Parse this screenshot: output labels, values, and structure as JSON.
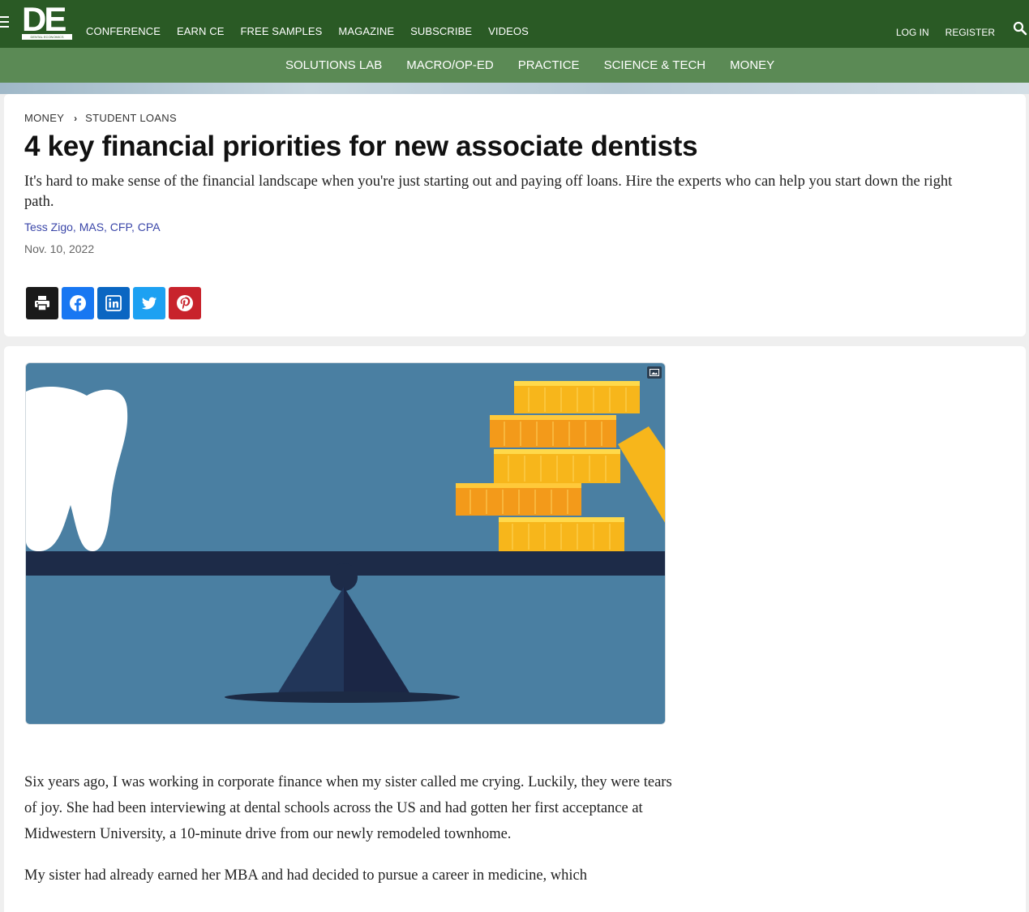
{
  "brand": {
    "logo_letters": "DE",
    "logo_sub": "DENTAL ECONOMICS"
  },
  "topnav": {
    "items": [
      "CONFERENCE",
      "EARN CE",
      "FREE SAMPLES",
      "MAGAZINE",
      "SUBSCRIBE",
      "VIDEOS"
    ],
    "login": "LOG IN",
    "register": "REGISTER"
  },
  "subnav": {
    "items": [
      "SOLUTIONS LAB",
      "MACRO/OP-ED",
      "PRACTICE",
      "SCIENCE & TECH",
      "MONEY"
    ]
  },
  "article": {
    "breadcrumb": [
      "MONEY",
      "STUDENT LOANS"
    ],
    "title": "4 key financial priorities for new associate dentists",
    "dek": "It's hard to make sense of the financial landscape when you're just starting out and paying off loans. Hire the experts who can help you start down the right path.",
    "author": "Tess Zigo, MAS, CFP, CPA",
    "date": "Nov. 10, 2022",
    "paragraphs": [
      "Six years ago, I was working in corporate finance when my sister called me crying. Luckily, they were tears of joy. She had been interviewing at dental schools across the US and had gotten her first acceptance at Midwestern University, a 10-minute drive from our newly remodeled townhome.",
      "My sister had already earned her MBA and had decided to pursue a career in medicine, which"
    ]
  },
  "share_buttons": [
    {
      "name": "print",
      "icon": "print-icon",
      "color": "#1a1a1a"
    },
    {
      "name": "facebook",
      "icon": "facebook-icon",
      "color": "#1877f2"
    },
    {
      "name": "linkedin",
      "icon": "linkedin-icon",
      "color": "#0a66c2"
    },
    {
      "name": "twitter",
      "icon": "twitter-icon",
      "color": "#1da1f2"
    },
    {
      "name": "pinterest",
      "icon": "pinterest-icon",
      "color": "#c8232c"
    }
  ],
  "colors": {
    "topbar": "#2a5a25",
    "subbar": "#5b8a55",
    "author_link": "#3a46a8"
  }
}
